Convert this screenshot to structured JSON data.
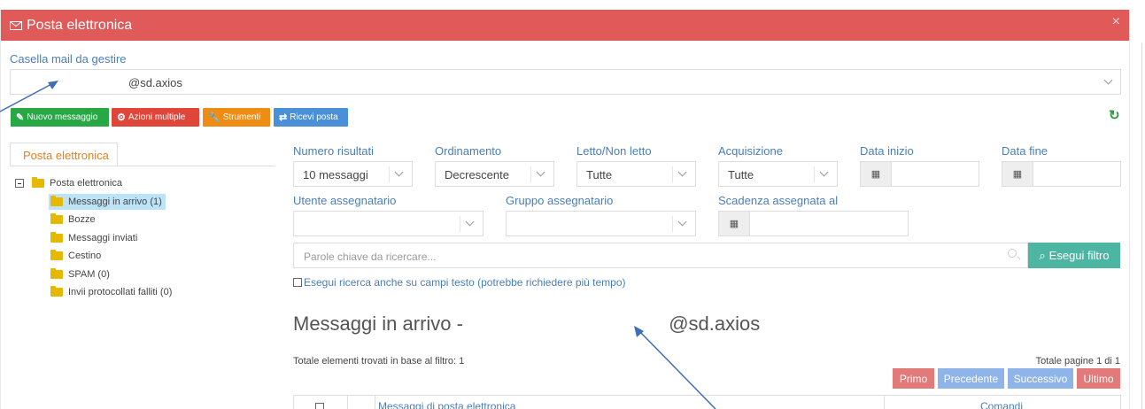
{
  "modal": {
    "title": "Posta elettronica",
    "close": "×"
  },
  "mailbox": {
    "label": "Casella mail da gestire",
    "value": "@sd.axios"
  },
  "toolbar": {
    "new_message": "Nuovo messaggio",
    "multiple_actions": "Azioni multiple",
    "tools": "Strumenti",
    "receive_mail": "Ricevi posta"
  },
  "sidebar": {
    "tab": "Posta elettronica",
    "root": "Posta elettronica",
    "items": [
      {
        "label": "Messaggi in arrivo (1)",
        "selected": true
      },
      {
        "label": "Bozze"
      },
      {
        "label": "Messaggi inviati"
      },
      {
        "label": "Cestino"
      },
      {
        "label": "SPAM (0)"
      },
      {
        "label": "Invii protocollati falliti (0)"
      }
    ]
  },
  "filters": {
    "num_results": {
      "label": "Numero risultati",
      "value": "10 messaggi"
    },
    "ordering": {
      "label": "Ordinamento",
      "value": "Decrescente"
    },
    "read": {
      "label": "Letto/Non letto",
      "value": "Tutte"
    },
    "acquisition": {
      "label": "Acquisizione",
      "value": "Tutte"
    },
    "start_date": {
      "label": "Data inizio"
    },
    "end_date": {
      "label": "Data fine"
    },
    "assignee_user": {
      "label": "Utente assegnatario"
    },
    "assignee_group": {
      "label": "Gruppo assegnatario"
    },
    "deadline": {
      "label": "Scadenza assegnata al"
    },
    "keywords_placeholder": "Parole chiave da ricercare...",
    "run_filter": "Esegui filtro",
    "fulltext_checkbox": "Esegui ricerca anche su campi testo (potrebbe richiedere più tempo)"
  },
  "results": {
    "title_prefix": "Messaggi in arrivo -",
    "title_suffix": "@sd.axios",
    "total_found": "Totale elementi trovati in base al filtro: 1",
    "total_pages": "Totale pagine 1 di 1",
    "pagination": {
      "first": "Primo",
      "prev": "Precedente",
      "next": "Successivo",
      "last": "Ultimo"
    },
    "columns": {
      "messages": "Messaggi di posta elettronica",
      "commands": "Comandi"
    }
  },
  "colors": {
    "header": "#e15a5a",
    "green_btn": "#27a844",
    "red_btn": "#e0453a",
    "orange_btn": "#ef8c14",
    "blue_btn": "#4a90d9",
    "teal_btn": "#4db6a2",
    "pag_red": "#e27a7a",
    "pag_blue": "#8fb4ea"
  }
}
